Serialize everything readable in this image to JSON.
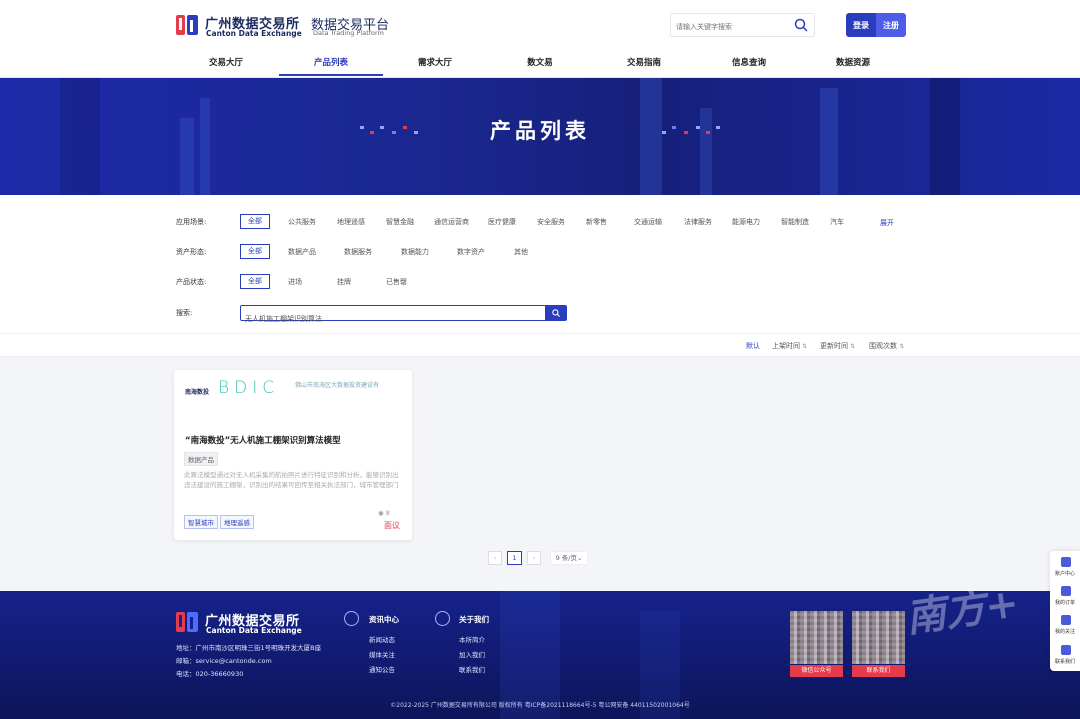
{
  "header": {
    "logo_cn": "广州数据交易所",
    "logo_en": "Canton Data Exchange",
    "platform_cn": "数据交易平台",
    "platform_en": "Data Trading Platform",
    "search_placeholder": "请输入关键字搜索",
    "login_label": "登录",
    "register_label": "注册",
    "brand_color": "#2b3dbf",
    "login_color": "#2b3dbf",
    "register_color": "#4f5ce8",
    "nav": [
      "交易大厅",
      "产品列表",
      "需求大厅",
      "数文易",
      "交易指南",
      "信息查询",
      "数据资源"
    ],
    "nav_active": "产品列表"
  },
  "banner": {
    "title": "产品列表"
  },
  "filters": {
    "scene_label": "应用场景:",
    "scene_options": [
      "全部",
      "公共服务",
      "地理遥感",
      "智慧金融",
      "通信运营商",
      "医疗健康",
      "安全服务",
      "新零售",
      "交通运输",
      "法律服务",
      "能源电力",
      "智能制造",
      "汽车"
    ],
    "expand_label": "展开",
    "form_label": "资产形态:",
    "form_options": [
      "全部",
      "数据产品",
      "数据服务",
      "数据能力",
      "数字资产",
      "其他"
    ],
    "status_label": "产品状态:",
    "status_options": [
      "全部",
      "进场",
      "挂牌",
      "已售罄"
    ],
    "search_label": "搜索:",
    "search_value": "无人机施工棚架识别算法"
  },
  "sort": {
    "items": [
      "默认",
      "上架时间",
      "更新时间",
      "围观次数"
    ],
    "active": "默认"
  },
  "product": {
    "logo_text": "南海数投",
    "logo_mark": "BDIC",
    "org_name": "佛山市南海区大数据投资建设有",
    "title": "“南海数投”无人机施工棚架识别算法模型",
    "type_tag": "数据产品",
    "description": "此算法模型通过对无人机采集的航拍照片进行特征识别和分析，能够识别出违法建设的施工棚架，识别出的结果可回传至相关执法部门，城市管理部门通过",
    "tags": [
      "智慧城市",
      "地理遥感"
    ],
    "views": "8",
    "price": "面议",
    "price_color": "#e53b4b"
  },
  "pagination": {
    "current": "1",
    "page_size": "9 条/页"
  },
  "footer": {
    "logo_cn": "广州数据交易所",
    "logo_en": "Canton Data Exchange",
    "address": "地址：广州市南沙区明珠三街1号明珠开发大厦B座",
    "email": "邮箱：service@cantonde.com",
    "phone": "电话：020-36660930",
    "news_head": "资讯中心",
    "news_links": [
      "新闻动态",
      "媒体关注",
      "通知公告"
    ],
    "about_head": "关于我们",
    "about_links": [
      "本所简介",
      "加入我们",
      "联系我们"
    ],
    "qr1_caption": "微信公众号",
    "qr2_caption": "联系我们",
    "copyright": "©2022-2025 广州数据交易所有限公司 版权所有    粤ICP备2021118664号-5    粤公网安备 44011502001064号"
  },
  "float_menu": [
    "账户中心",
    "我的订单",
    "我的关注",
    "联系我们"
  ],
  "watermark": "南方+"
}
